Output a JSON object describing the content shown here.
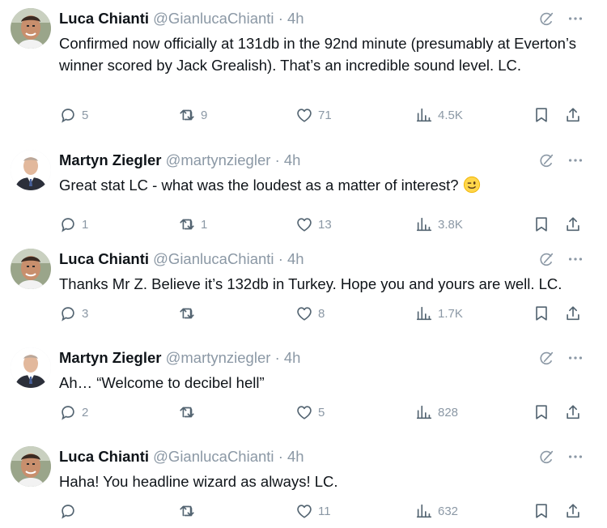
{
  "tweets": [
    {
      "author": "luca",
      "name": "Luca Chianti",
      "handle": "@GianlucaChianti",
      "separator": "·",
      "time": "4h",
      "text": "Confirmed now officially at 131db in the 92nd minute (presumably at Everton’s winner scored by Jack Grealish). That’s an incredible sound level. LC.",
      "replies": "5",
      "retweets": "9",
      "likes": "71",
      "views": "4.5K"
    },
    {
      "author": "martyn",
      "name": "Martyn Ziegler",
      "handle": "@martynziegler",
      "separator": "·",
      "time": "4h",
      "text": "Great stat LC - what was the loudest as a matter of interest?",
      "emoji": "winking-face-emoji",
      "replies": "1",
      "retweets": "1",
      "likes": "13",
      "views": "3.8K"
    },
    {
      "author": "luca",
      "name": "Luca Chianti",
      "handle": "@GianlucaChianti",
      "separator": "·",
      "time": "4h",
      "text": "Thanks Mr Z. Believe it’s 132db in Turkey. Hope you and yours are well. LC.",
      "replies": "3",
      "retweets": "",
      "likes": "8",
      "views": "1.7K"
    },
    {
      "author": "martyn",
      "name": "Martyn Ziegler",
      "handle": "@martynziegler",
      "separator": "·",
      "time": "4h",
      "text": "Ah… “Welcome to decibel hell”",
      "replies": "2",
      "retweets": "",
      "likes": "5",
      "views": "828"
    },
    {
      "author": "luca",
      "name": "Luca Chianti",
      "handle": "@GianlucaChianti",
      "separator": "·",
      "time": "4h",
      "text": "Haha! You headline wizard as always! LC.",
      "replies": "",
      "retweets": "",
      "likes": "11",
      "views": "632"
    }
  ],
  "icons": {
    "reply": "reply-icon",
    "retweet": "retweet-icon",
    "like": "heart-icon",
    "views": "views-chart-icon",
    "bookmark": "bookmark-icon",
    "share": "share-icon",
    "grok": "grok-icon",
    "more": "more-dots-icon"
  },
  "colors": {
    "text": "#0f1419",
    "secondary": "#8b98a5",
    "icon": "#536471"
  }
}
